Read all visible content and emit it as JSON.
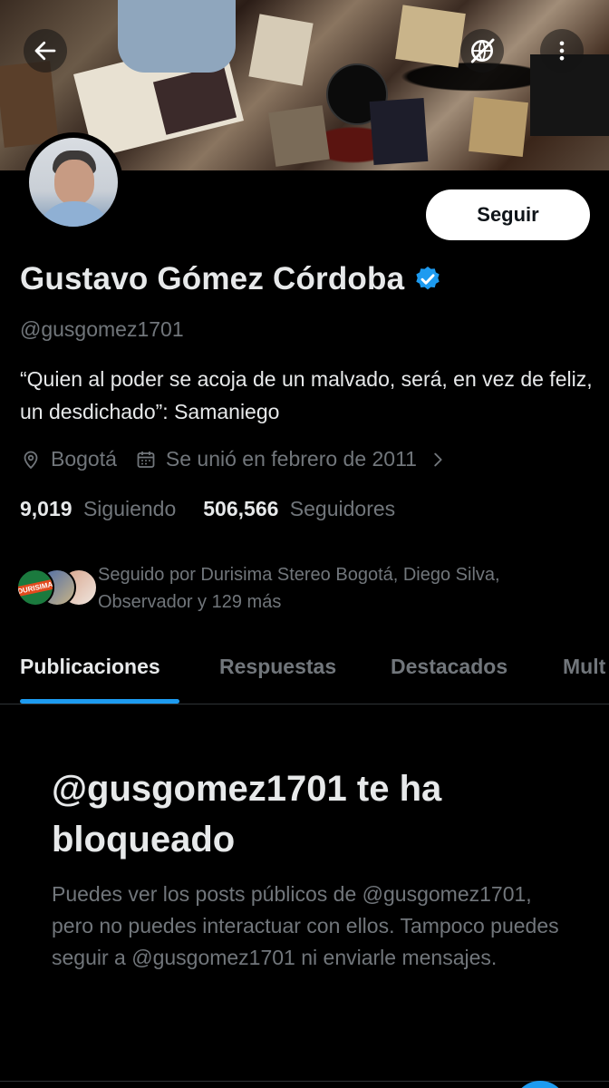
{
  "header": {
    "back_icon": "arrow-left-icon",
    "translate_icon": "globe-slash-icon",
    "more_icon": "vertical-dots-icon"
  },
  "profile": {
    "name": "Gustavo Gómez Córdoba",
    "verified": true,
    "verified_color": "#1d9bf0",
    "handle": "@gusgomez1701",
    "bio": "“Quien al poder se acoja de un malvado, será, en vez de feliz, un desdichado”: Samaniego",
    "location": "Bogotá",
    "joined": "Se unió en febrero de 2011",
    "follow_label": "Seguir"
  },
  "stats": {
    "following_count": "9,019",
    "following_label": "Siguiendo",
    "followers_count": "506,566",
    "followers_label": "Seguidores"
  },
  "followed_by": {
    "text": "Seguido por Durisima Stereo Bogotá, Diego Silva, Observador y 129 más",
    "avatar_label": "DURISIMA"
  },
  "tabs": [
    {
      "label": "Publicaciones",
      "active": true
    },
    {
      "label": "Respuestas",
      "active": false
    },
    {
      "label": "Destacados",
      "active": false
    },
    {
      "label": "Mult",
      "active": false
    }
  ],
  "blocked": {
    "title": "@gusgomez1701 te ha bloqueado",
    "description": "Puedes ver los posts públicos de @gusgomez1701, pero no puedes interactuar con ellos. Tampoco puedes seguir a @gusgomez1701 ni enviarle mensajes."
  },
  "colors": {
    "accent": "#1d9bf0",
    "background": "#000000",
    "secondary_text": "#71767b"
  }
}
